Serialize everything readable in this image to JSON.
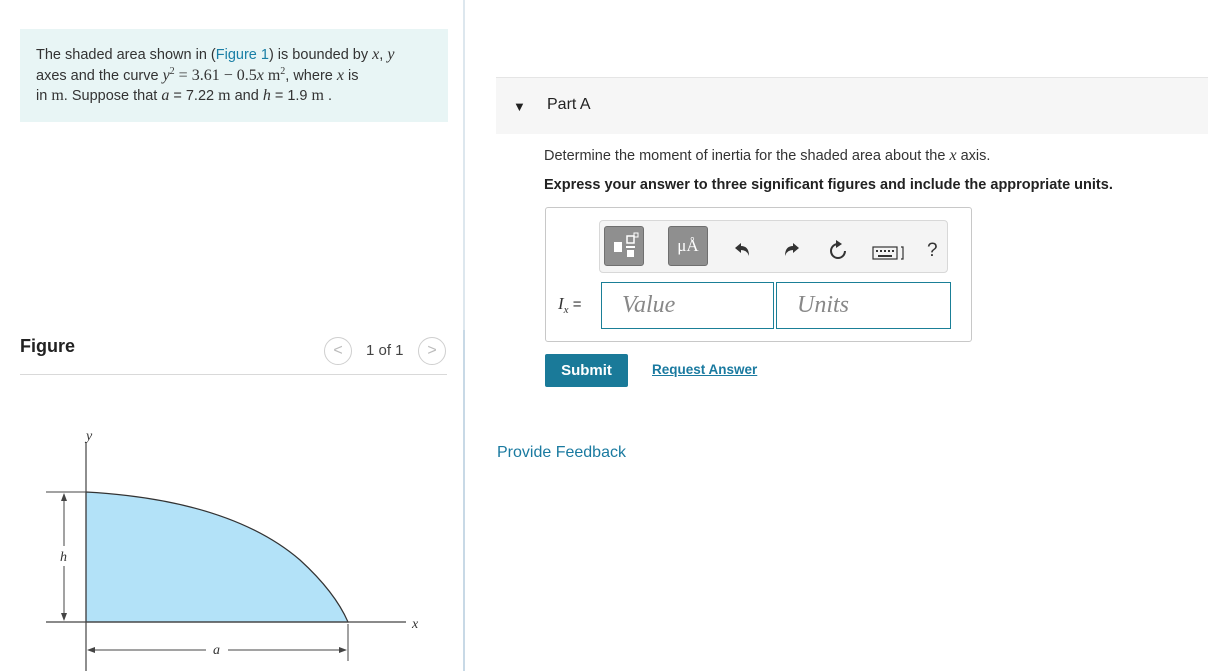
{
  "problem": {
    "t1": "The shaded area shown in (",
    "figure_link": "Figure 1",
    "t2": ") is bounded by ",
    "x": "x",
    "comma": ", ",
    "y": "y",
    "t3": "axes and the curve ",
    "eq_y": "y",
    "eq_rest": " = 3.61 − 0.5",
    "eq_x": "x",
    "eq_unit": " m",
    "t4": ", where ",
    "t5": " is",
    "t6": "in ",
    "m": "m",
    "t7": ". Suppose that ",
    "a": "a",
    "a_val": " = 7.22 ",
    "a_unit": "m",
    "t8": " and ",
    "h": "h",
    "h_val": " = 1.9 ",
    "h_unit": "m",
    "t9": " ."
  },
  "figure": {
    "title": "Figure",
    "counter": "1 of 1",
    "prev": "<",
    "next": ">",
    "label_y": "y",
    "label_x": "x",
    "label_h": "h",
    "label_a": "a",
    "fill_color": "#b3e2f8"
  },
  "partA": {
    "label": "Part A",
    "question_pre": "Determine the moment of inertia for the shaded area about the ",
    "question_var": "x",
    "question_post": " axis.",
    "instructions": "Express your answer to three significant figures and include the appropriate units.",
    "answer_label_I": "I",
    "answer_label_sub": "x",
    "answer_label_eq": " =",
    "value_placeholder": "Value",
    "units_placeholder": "Units",
    "submit": "Submit",
    "request_answer": "Request Answer",
    "symbols_button": "μÅ",
    "help": "?"
  },
  "feedback": "Provide Feedback"
}
